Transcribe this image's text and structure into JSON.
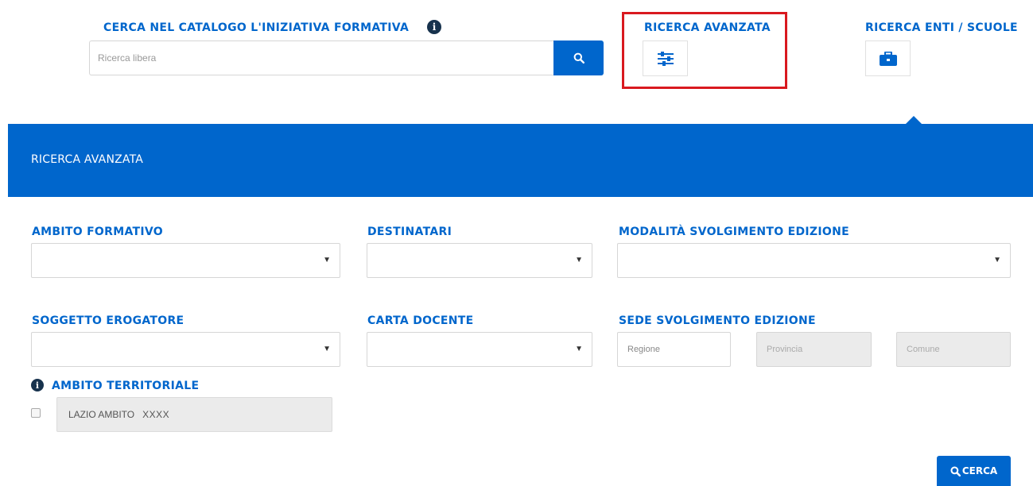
{
  "top": {
    "catalog_heading": "CERCA NEL CATALOGO L'INIZIATIVA FORMATIVA",
    "search_placeholder": "Ricerca libera",
    "advanced_heading": "RICERCA AVANZATA",
    "entities_heading": "RICERCA ENTI / SCUOLE",
    "info_icon": "info-icon",
    "search_icon": "search-icon",
    "sliders_icon": "sliders-icon",
    "briefcase_icon": "briefcase-icon"
  },
  "banner": {
    "title": "RICERCA AVANZATA"
  },
  "form": {
    "ambito_formativo": {
      "label": "AMBITO FORMATIVO",
      "value": ""
    },
    "destinatari": {
      "label": "DESTINATARI",
      "value": ""
    },
    "modalita": {
      "label": "MODALITÀ SVOLGIMENTO EDIZIONE",
      "value": ""
    },
    "soggetto_erogatore": {
      "label": "SOGGETTO EROGATORE",
      "value": ""
    },
    "carta_docente": {
      "label": "CARTA DOCENTE",
      "value": ""
    },
    "sede": {
      "label": "SEDE SVOLGIMENTO EDIZIONE",
      "regione_placeholder": "Regione",
      "provincia_placeholder": "Provincia",
      "comune_placeholder": "Comune"
    },
    "ambito_territoriale": {
      "label": "AMBITO TERRITORIALE",
      "prefix": "LAZIO AMBITO",
      "value": "XXXX",
      "checked": false
    },
    "submit_label": "CERCA"
  },
  "colors": {
    "primary": "#0066cc",
    "highlight": "#d9191f",
    "dark": "#17324d"
  }
}
